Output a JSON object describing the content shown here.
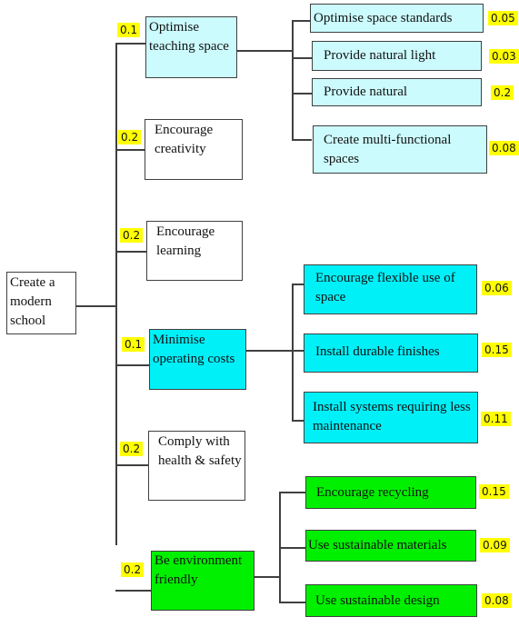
{
  "root": {
    "label": "Create a modern school"
  },
  "criteria": [
    {
      "label": "Optimise teaching space",
      "weight": "0.1",
      "color": "#ccfbfd",
      "sub": [
        {
          "label": "Optimise space standards",
          "weight": "0.05"
        },
        {
          "label": "Provide natural light",
          "weight": "0.03"
        },
        {
          "label": "Provide natural",
          "weight": "0.2"
        },
        {
          "label": "Create multi-functional spaces",
          "weight": "0.08"
        }
      ]
    },
    {
      "label": "Encourage creativity",
      "weight": "0.2",
      "color": "#ffffff",
      "sub": []
    },
    {
      "label": "Encourage learning",
      "weight": "0.2",
      "color": "#ffffff",
      "sub": []
    },
    {
      "label": "Minimise operating costs",
      "weight": "0.1",
      "color": "#00f0f8",
      "sub": [
        {
          "label": "Encourage flexible use of space",
          "weight": "0.06"
        },
        {
          "label": "Install durable finishes",
          "weight": "0.15"
        },
        {
          "label": "Install systems requiring less maintenance",
          "weight": "0.11"
        }
      ]
    },
    {
      "label": "Comply with health & safety",
      "weight": "0.2",
      "color": "#ffffff",
      "sub": []
    },
    {
      "label": "Be environment friendly",
      "weight": "0.2",
      "color": "#00f000",
      "sub": [
        {
          "label": "Encourage recycling",
          "weight": "0.15"
        },
        {
          "label": "Use sustainable materials",
          "weight": "0.09"
        },
        {
          "label": "Use sustainable design",
          "weight": "0.08"
        }
      ]
    }
  ],
  "colors": {
    "weight_highlight": "#ffff00",
    "line": "#404040"
  }
}
